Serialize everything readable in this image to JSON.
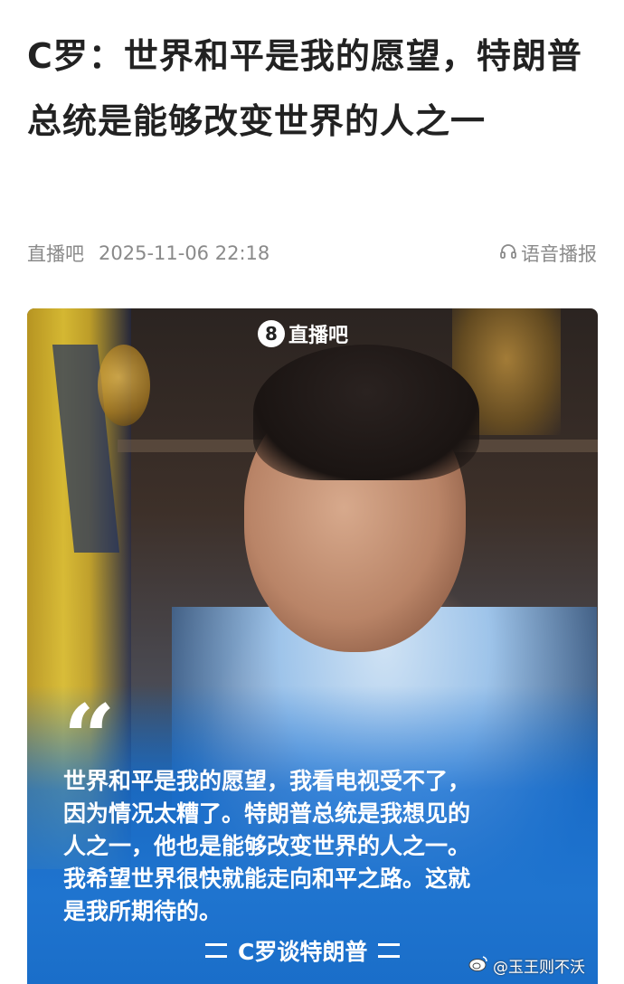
{
  "article": {
    "title": "C罗：世界和平是我的愿望，特朗普总统是能够改变世界的人之一",
    "source": "直播吧",
    "timestamp": "2025-11-06 22:18",
    "audio_label": "语音播报",
    "audio_icon": "headphone-icon"
  },
  "image": {
    "brand_badge": "8",
    "brand_name": "直播吧",
    "quote_mark": "“",
    "quote_lines": [
      "世界和平是我的愿望，我看电视受不了，",
      "因为情况太糟了。特朗普总统是我想见的",
      "人之一，他也是能够改变世界的人之一。",
      "我希望世界很快就能走向和平之路。这就",
      "是我所期待的。"
    ],
    "attribution": "C罗谈特朗普",
    "watermark": "@玉王则不沃",
    "watermark_icon": "weibo-icon"
  }
}
